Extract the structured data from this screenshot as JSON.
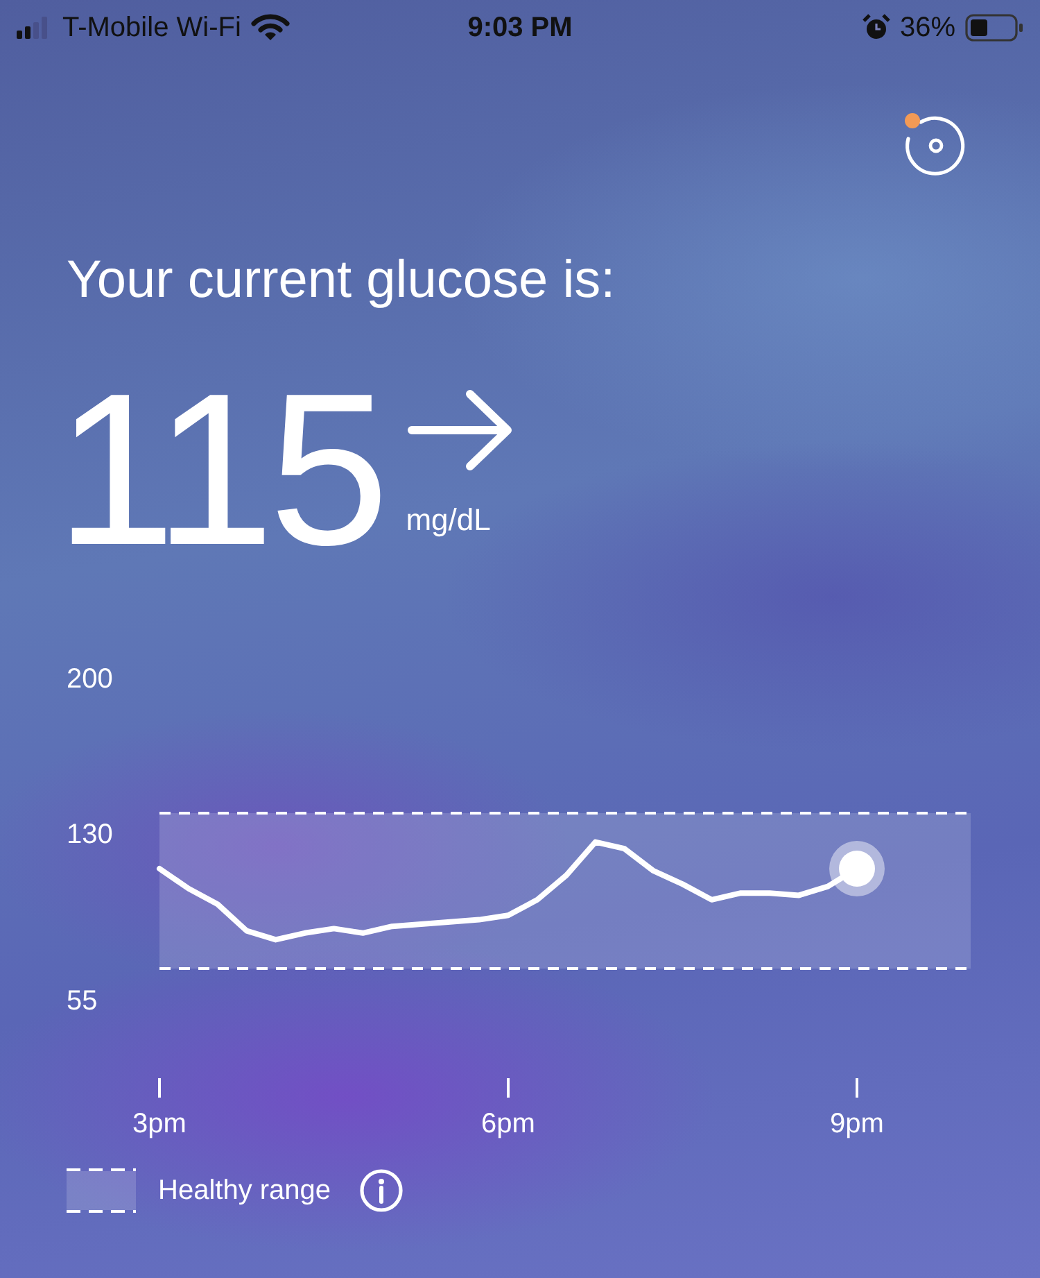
{
  "status_bar": {
    "carrier": "T-Mobile Wi-Fi",
    "time": "9:03 PM",
    "battery": "36%"
  },
  "title": "Your current glucose is:",
  "reading": {
    "value": "115",
    "unit": "mg/dL"
  },
  "chart_data": {
    "type": "line",
    "categories": [
      "3pm",
      null,
      null,
      null,
      null,
      null,
      null,
      null,
      null,
      null,
      null,
      null,
      "6pm",
      null,
      null,
      null,
      null,
      null,
      null,
      null,
      null,
      null,
      null,
      null,
      "9pm"
    ],
    "series": [
      {
        "color": "#ffffff",
        "values": [
          115,
          106,
          99,
          87,
          83,
          86,
          88,
          86,
          89,
          90,
          91,
          92,
          94,
          101,
          112,
          127,
          124,
          114,
          108,
          101,
          104,
          104,
          103,
          107,
          115
        ]
      }
    ],
    "ylim": [
      55,
      200
    ],
    "yticks": [
      200,
      130,
      55
    ],
    "bands": [
      {
        "axis": "y",
        "from": 70,
        "to": 140
      }
    ],
    "ref_lines": [
      {
        "axis": "y",
        "value": 140
      },
      {
        "axis": "y",
        "value": 70
      }
    ]
  },
  "legend": {
    "label": "Healthy range"
  }
}
